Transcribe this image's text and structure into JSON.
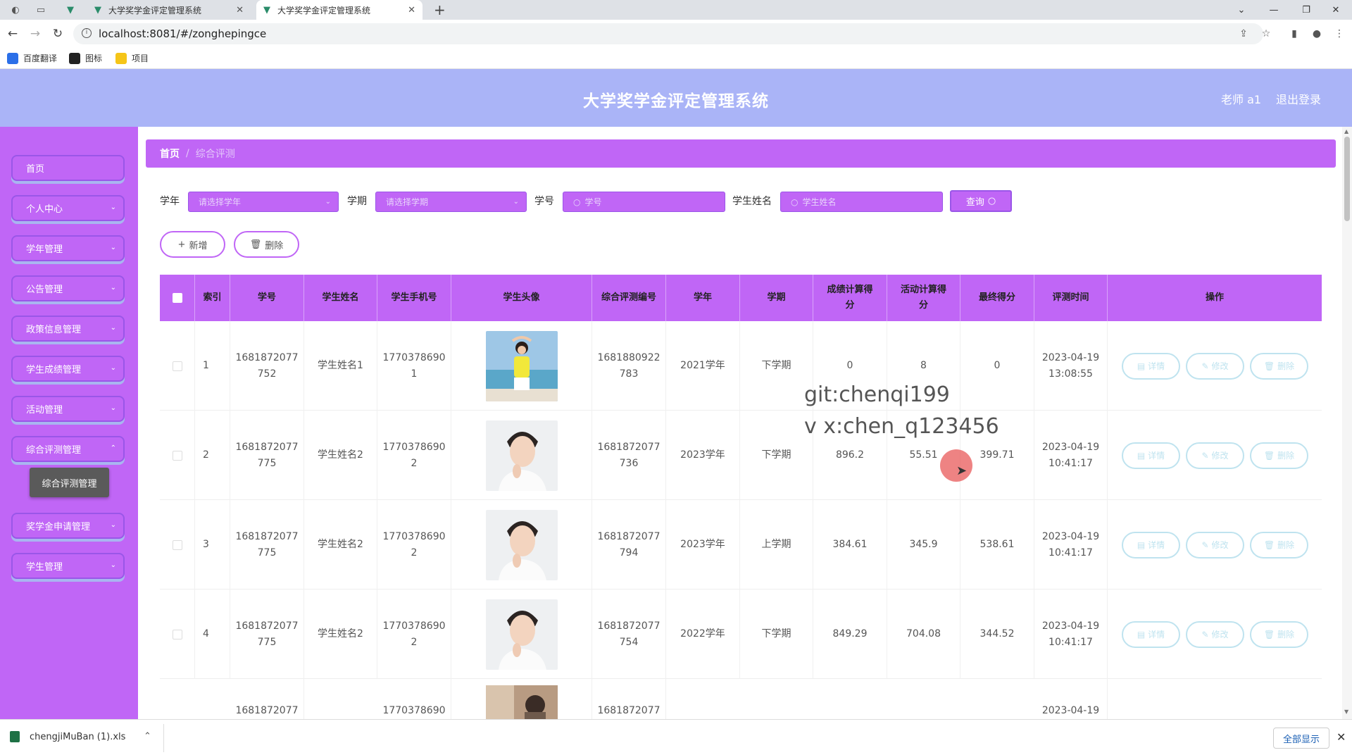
{
  "browser": {
    "tabs": [
      {
        "title": "大学奖学金评定管理系统"
      },
      {
        "title": "大学奖学金评定管理系统"
      }
    ],
    "url": "localhost:8081/#/zonghepingce",
    "bookmarks": [
      "百度翻译",
      "图标",
      "项目"
    ]
  },
  "app": {
    "title": "大学奖学金评定管理系统",
    "user": "老师 a1",
    "logout": "退出登录"
  },
  "sidebar": {
    "items": [
      {
        "label": "首页",
        "has_arrow": false
      },
      {
        "label": "个人中心",
        "has_arrow": true
      },
      {
        "label": "学年管理",
        "has_arrow": true
      },
      {
        "label": "公告管理",
        "has_arrow": true
      },
      {
        "label": "政策信息管理",
        "has_arrow": true
      },
      {
        "label": "学生成绩管理",
        "has_arrow": true
      },
      {
        "label": "活动管理",
        "has_arrow": true
      },
      {
        "label": "综合评测管理",
        "has_arrow": true
      },
      {
        "label": "奖学金申请管理",
        "has_arrow": true
      },
      {
        "label": "学生管理",
        "has_arrow": true
      }
    ],
    "submenu_active": "综合评测管理"
  },
  "breadcrumb": {
    "home": "首页",
    "separator": "/",
    "current": "综合评测"
  },
  "search": {
    "year_label": "学年",
    "year_placeholder": "请选择学年",
    "term_label": "学期",
    "term_placeholder": "请选择学期",
    "id_label": "学号",
    "id_placeholder": "学号",
    "name_label": "学生姓名",
    "name_placeholder": "学生姓名",
    "query_button": "查询"
  },
  "actions": {
    "add": "新增",
    "delete": "删除"
  },
  "table": {
    "headers": {
      "index": "索引",
      "student_id": "学号",
      "name": "学生姓名",
      "phone": "学生手机号",
      "avatar": "学生头像",
      "eval_no": "综合评测编号",
      "year": "学年",
      "term": "学期",
      "grade_score": "成绩计算得分",
      "activity_score": "活动计算得分",
      "final_score": "最终得分",
      "eval_time": "评测时间",
      "ops": "操作"
    },
    "op_buttons": {
      "detail": "详情",
      "edit": "修改",
      "delete": "删除"
    },
    "rows": [
      {
        "index": "1",
        "student_id_1": "1681872077",
        "student_id_2": "752",
        "name": "学生姓名1",
        "phone_1": "1770378690",
        "phone_2": "1",
        "avatar": "girl-yellow-shirt-beach",
        "eval_no_1": "1681880922",
        "eval_no_2": "783",
        "year": "2021学年",
        "term": "下学期",
        "grade_score": "0",
        "activity_score": "8",
        "final_score": "0",
        "date": "2023-04-19",
        "time": "13:08:55"
      },
      {
        "index": "2",
        "student_id_1": "1681872077",
        "student_id_2": "775",
        "name": "学生姓名2",
        "phone_1": "1770378690",
        "phone_2": "2",
        "avatar": "boy-white-shirt",
        "eval_no_1": "1681872077",
        "eval_no_2": "736",
        "year": "2023学年",
        "term": "下学期",
        "grade_score": "896.2",
        "activity_score": "55.51",
        "final_score": "399.71",
        "date": "2023-04-19",
        "time": "10:41:17"
      },
      {
        "index": "3",
        "student_id_1": "1681872077",
        "student_id_2": "775",
        "name": "学生姓名2",
        "phone_1": "1770378690",
        "phone_2": "2",
        "avatar": "boy-white-shirt",
        "eval_no_1": "1681872077",
        "eval_no_2": "794",
        "year": "2023学年",
        "term": "上学期",
        "grade_score": "384.61",
        "activity_score": "345.9",
        "final_score": "538.61",
        "date": "2023-04-19",
        "time": "10:41:17"
      },
      {
        "index": "4",
        "student_id_1": "1681872077",
        "student_id_2": "775",
        "name": "学生姓名2",
        "phone_1": "1770378690",
        "phone_2": "2",
        "avatar": "boy-white-shirt",
        "eval_no_1": "1681872077",
        "eval_no_2": "754",
        "year": "2022学年",
        "term": "下学期",
        "grade_score": "849.29",
        "activity_score": "704.08",
        "final_score": "344.52",
        "date": "2023-04-19",
        "time": "10:41:17"
      },
      {
        "index": "",
        "student_id_1": "1681872077",
        "student_id_2": "",
        "name": "",
        "phone_1": "1770378690",
        "phone_2": "",
        "avatar": "photo-partial",
        "eval_no_1": "1681872077",
        "eval_no_2": "",
        "year": "",
        "term": "",
        "grade_score": "",
        "activity_score": "",
        "final_score": "",
        "date": "2023-04-19",
        "time": ""
      }
    ]
  },
  "watermark": {
    "line1": "git:chenqi199",
    "line2": "v x:chen_q123456"
  },
  "download": {
    "filename": "chengjiMuBan (1).xls",
    "show_all": "全部显示"
  },
  "colors": {
    "header": "#aab4f7",
    "accent": "#c066f6",
    "accent_border": "#9a56e8",
    "op_button": "#bfe3ef"
  }
}
